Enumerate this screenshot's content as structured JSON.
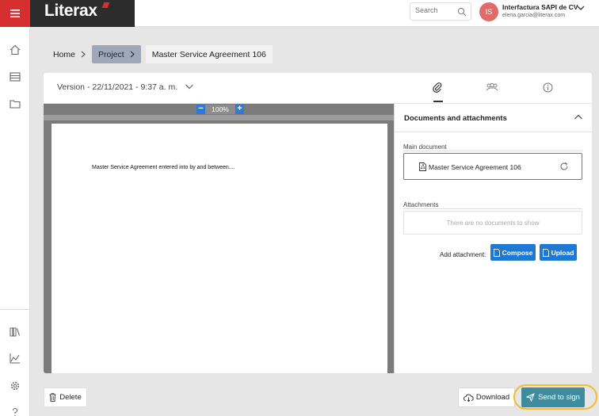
{
  "app": {
    "brand": "Literax",
    "brand_color": "#d62f2f"
  },
  "header": {
    "search_placeholder": "Search",
    "avatar_initials": "IS",
    "company_name": "Interfactura SAPI de CV",
    "user_email": "elena.garcia@literax.com"
  },
  "sidebar": {
    "icons": [
      "home-icon",
      "templates-icon",
      "folder-icon",
      "library-icon",
      "reports-icon",
      "gear-icon",
      "help-icon"
    ]
  },
  "breadcrumb": {
    "home": "Home",
    "project": "Project",
    "current": "Master Service Agreement 106"
  },
  "document": {
    "version_label": "Version - 22/11/2021 - 9:37 a. m.",
    "zoom_minus": "−",
    "zoom_level": "100%",
    "zoom_plus": "+",
    "page_text": "Master Service Agreement entered into by and between...."
  },
  "tabs": [
    "paperclip-icon",
    "people-icon",
    "info-icon"
  ],
  "panel": {
    "title": "Documents and attachments",
    "main_document_label": "Main document",
    "main_document_name": "Master Service Agreement 106",
    "attachments_label": "Attachments",
    "attachments_empty": "There are no documents to show",
    "add_attachment_label": "Add attachment:",
    "compose_label": "Compose",
    "upload_label": "Upload"
  },
  "actions": {
    "delete_label": "Delete",
    "download_label": "Download",
    "send_label": "Send to sign",
    "primary_color": "#1f78d1",
    "send_color": "#3f8c9e",
    "highlight_color": "#f0bf2a"
  }
}
